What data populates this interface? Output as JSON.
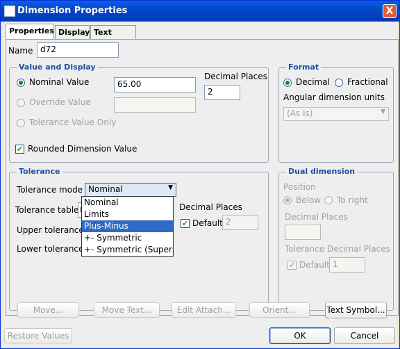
{
  "window": {
    "title": "Dimension Properties",
    "close_glyph": "X"
  },
  "tabs": [
    "Properties",
    "Display",
    "Text Style"
  ],
  "name": {
    "label": "Name",
    "value": "d72"
  },
  "value_display": {
    "title": "Value and Display",
    "nominal_label": "Nominal Value",
    "nominal_value": "65.00",
    "override_label": "Override Value",
    "override_value": "",
    "tolerance_only_label": "Tolerance Value Only",
    "decimal_places_label": "Decimal Places",
    "decimal_places_value": "2",
    "rounded_label": "Rounded Dimension Value"
  },
  "format": {
    "title": "Format",
    "decimal_label": "Decimal",
    "fractional_label": "Fractional",
    "angular_label": "Angular dimension units",
    "angular_value": "(As Is)"
  },
  "tolerance": {
    "title": "Tolerance",
    "mode_label": "Tolerance mode",
    "mode_value": "Nominal",
    "table_label": "Tolerance table",
    "table_value": "n",
    "upper_label": "Upper tolerance",
    "lower_label": "Lower tolerance",
    "decimal_places_label": "Decimal Places",
    "default_label": "Default",
    "default_value": "2",
    "mode_options": [
      "Nominal",
      "Limits",
      "Plus-Minus",
      "+- Symmetric",
      "+- Symmetric (Superscri"
    ]
  },
  "dual": {
    "title": "Dual dimension",
    "position_label": "Position",
    "below_label": "Below",
    "right_label": "To right",
    "decimal_places_label": "Decimal Places",
    "decimal_places_value": "",
    "tol_decimal_label": "Tolerance Decimal Places",
    "default_label": "Default",
    "default_value": "1"
  },
  "buttons": {
    "move": "Move...",
    "move_text": "Move Text...",
    "edit_attach": "Edit Attach...",
    "orient": "Orient...",
    "text_symbol": "Text Symbol...",
    "restore": "Restore Values",
    "ok": "OK",
    "cancel": "Cancel"
  }
}
